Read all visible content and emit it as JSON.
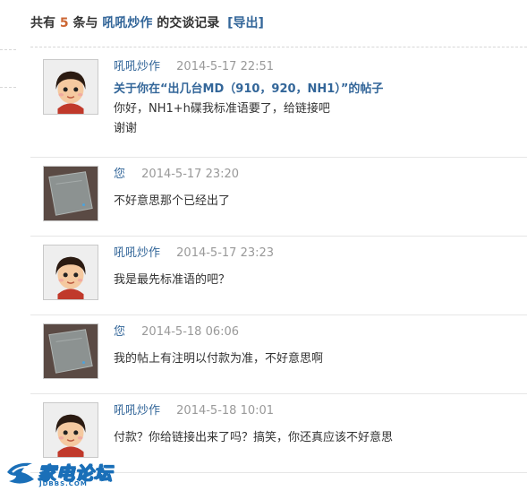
{
  "header": {
    "prefix": "共有",
    "count": "5",
    "middle": "条与",
    "username": "吼吼炒作",
    "suffix": "的交谈记录",
    "export_label": "[导出]"
  },
  "messages": [
    {
      "author": "吼吼炒作",
      "time": "2014-5-17 22:51",
      "avatar": "cartoon-girl-avatar",
      "thread_title": "关于你在“出几台MD（910，920，NH1）”的帖子",
      "lines": [
        "你好，NH1+h碟我标准语要了，给链接吧",
        "谢谢"
      ]
    },
    {
      "author": "您",
      "time": "2014-5-17 23:20",
      "avatar": "device-photo-avatar",
      "lines": [
        "不好意思那个已经出了"
      ]
    },
    {
      "author": "吼吼炒作",
      "time": "2014-5-17 23:23",
      "avatar": "cartoon-girl-avatar",
      "lines": [
        "我是最先标准语的吧？"
      ]
    },
    {
      "author": "您",
      "time": "2014-5-18 06:06",
      "avatar": "device-photo-avatar",
      "lines": [
        "我的帖上有注明以付款为准，不好意思啊"
      ]
    },
    {
      "author": "吼吼炒作",
      "time": "2014-5-18 10:01",
      "avatar": "cartoon-girl-avatar",
      "lines": [
        "付款？你给链接出来了吗？搞笑，你还真应该不好意思"
      ]
    }
  ],
  "watermark": {
    "text": "家电论坛",
    "sub": "JDBBS.COM"
  },
  "colors": {
    "link": "#336699",
    "count": "#cc6633",
    "time": "#999999",
    "text": "#333333",
    "watermark": "#1a6fb8"
  }
}
